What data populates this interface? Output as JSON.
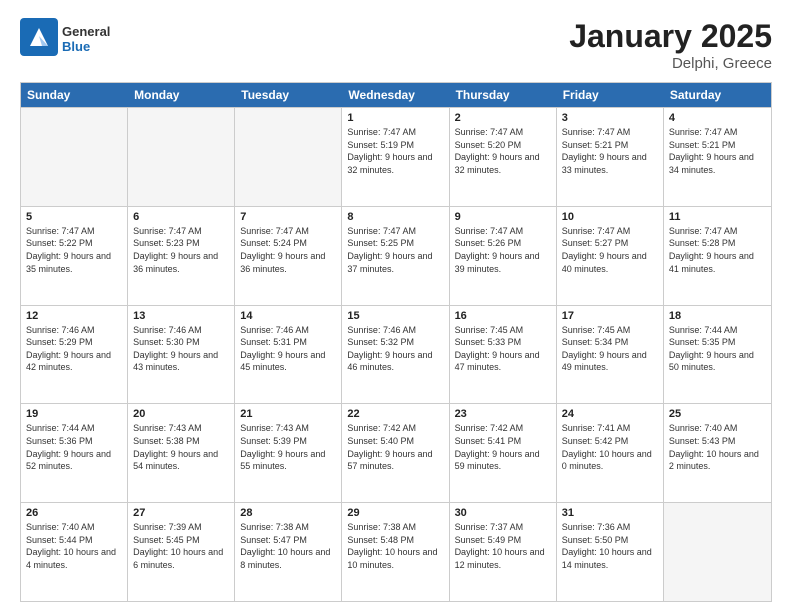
{
  "logo": {
    "general": "General",
    "blue": "Blue"
  },
  "title": "January 2025",
  "subtitle": "Delphi, Greece",
  "header_days": [
    "Sunday",
    "Monday",
    "Tuesday",
    "Wednesday",
    "Thursday",
    "Friday",
    "Saturday"
  ],
  "weeks": [
    [
      {
        "day": "",
        "empty": true
      },
      {
        "day": "",
        "empty": true
      },
      {
        "day": "",
        "empty": true
      },
      {
        "day": "1",
        "sunrise": "7:47 AM",
        "sunset": "5:19 PM",
        "daylight": "9 hours and 32 minutes."
      },
      {
        "day": "2",
        "sunrise": "7:47 AM",
        "sunset": "5:20 PM",
        "daylight": "9 hours and 32 minutes."
      },
      {
        "day": "3",
        "sunrise": "7:47 AM",
        "sunset": "5:21 PM",
        "daylight": "9 hours and 33 minutes."
      },
      {
        "day": "4",
        "sunrise": "7:47 AM",
        "sunset": "5:21 PM",
        "daylight": "9 hours and 34 minutes."
      }
    ],
    [
      {
        "day": "5",
        "sunrise": "7:47 AM",
        "sunset": "5:22 PM",
        "daylight": "9 hours and 35 minutes."
      },
      {
        "day": "6",
        "sunrise": "7:47 AM",
        "sunset": "5:23 PM",
        "daylight": "9 hours and 36 minutes."
      },
      {
        "day": "7",
        "sunrise": "7:47 AM",
        "sunset": "5:24 PM",
        "daylight": "9 hours and 36 minutes."
      },
      {
        "day": "8",
        "sunrise": "7:47 AM",
        "sunset": "5:25 PM",
        "daylight": "9 hours and 37 minutes."
      },
      {
        "day": "9",
        "sunrise": "7:47 AM",
        "sunset": "5:26 PM",
        "daylight": "9 hours and 39 minutes."
      },
      {
        "day": "10",
        "sunrise": "7:47 AM",
        "sunset": "5:27 PM",
        "daylight": "9 hours and 40 minutes."
      },
      {
        "day": "11",
        "sunrise": "7:47 AM",
        "sunset": "5:28 PM",
        "daylight": "9 hours and 41 minutes."
      }
    ],
    [
      {
        "day": "12",
        "sunrise": "7:46 AM",
        "sunset": "5:29 PM",
        "daylight": "9 hours and 42 minutes."
      },
      {
        "day": "13",
        "sunrise": "7:46 AM",
        "sunset": "5:30 PM",
        "daylight": "9 hours and 43 minutes."
      },
      {
        "day": "14",
        "sunrise": "7:46 AM",
        "sunset": "5:31 PM",
        "daylight": "9 hours and 45 minutes."
      },
      {
        "day": "15",
        "sunrise": "7:46 AM",
        "sunset": "5:32 PM",
        "daylight": "9 hours and 46 minutes."
      },
      {
        "day": "16",
        "sunrise": "7:45 AM",
        "sunset": "5:33 PM",
        "daylight": "9 hours and 47 minutes."
      },
      {
        "day": "17",
        "sunrise": "7:45 AM",
        "sunset": "5:34 PM",
        "daylight": "9 hours and 49 minutes."
      },
      {
        "day": "18",
        "sunrise": "7:44 AM",
        "sunset": "5:35 PM",
        "daylight": "9 hours and 50 minutes."
      }
    ],
    [
      {
        "day": "19",
        "sunrise": "7:44 AM",
        "sunset": "5:36 PM",
        "daylight": "9 hours and 52 minutes."
      },
      {
        "day": "20",
        "sunrise": "7:43 AM",
        "sunset": "5:38 PM",
        "daylight": "9 hours and 54 minutes."
      },
      {
        "day": "21",
        "sunrise": "7:43 AM",
        "sunset": "5:39 PM",
        "daylight": "9 hours and 55 minutes."
      },
      {
        "day": "22",
        "sunrise": "7:42 AM",
        "sunset": "5:40 PM",
        "daylight": "9 hours and 57 minutes."
      },
      {
        "day": "23",
        "sunrise": "7:42 AM",
        "sunset": "5:41 PM",
        "daylight": "9 hours and 59 minutes."
      },
      {
        "day": "24",
        "sunrise": "7:41 AM",
        "sunset": "5:42 PM",
        "daylight": "10 hours and 0 minutes."
      },
      {
        "day": "25",
        "sunrise": "7:40 AM",
        "sunset": "5:43 PM",
        "daylight": "10 hours and 2 minutes."
      }
    ],
    [
      {
        "day": "26",
        "sunrise": "7:40 AM",
        "sunset": "5:44 PM",
        "daylight": "10 hours and 4 minutes."
      },
      {
        "day": "27",
        "sunrise": "7:39 AM",
        "sunset": "5:45 PM",
        "daylight": "10 hours and 6 minutes."
      },
      {
        "day": "28",
        "sunrise": "7:38 AM",
        "sunset": "5:47 PM",
        "daylight": "10 hours and 8 minutes."
      },
      {
        "day": "29",
        "sunrise": "7:38 AM",
        "sunset": "5:48 PM",
        "daylight": "10 hours and 10 minutes."
      },
      {
        "day": "30",
        "sunrise": "7:37 AM",
        "sunset": "5:49 PM",
        "daylight": "10 hours and 12 minutes."
      },
      {
        "day": "31",
        "sunrise": "7:36 AM",
        "sunset": "5:50 PM",
        "daylight": "10 hours and 14 minutes."
      },
      {
        "day": "",
        "empty": true
      }
    ]
  ]
}
